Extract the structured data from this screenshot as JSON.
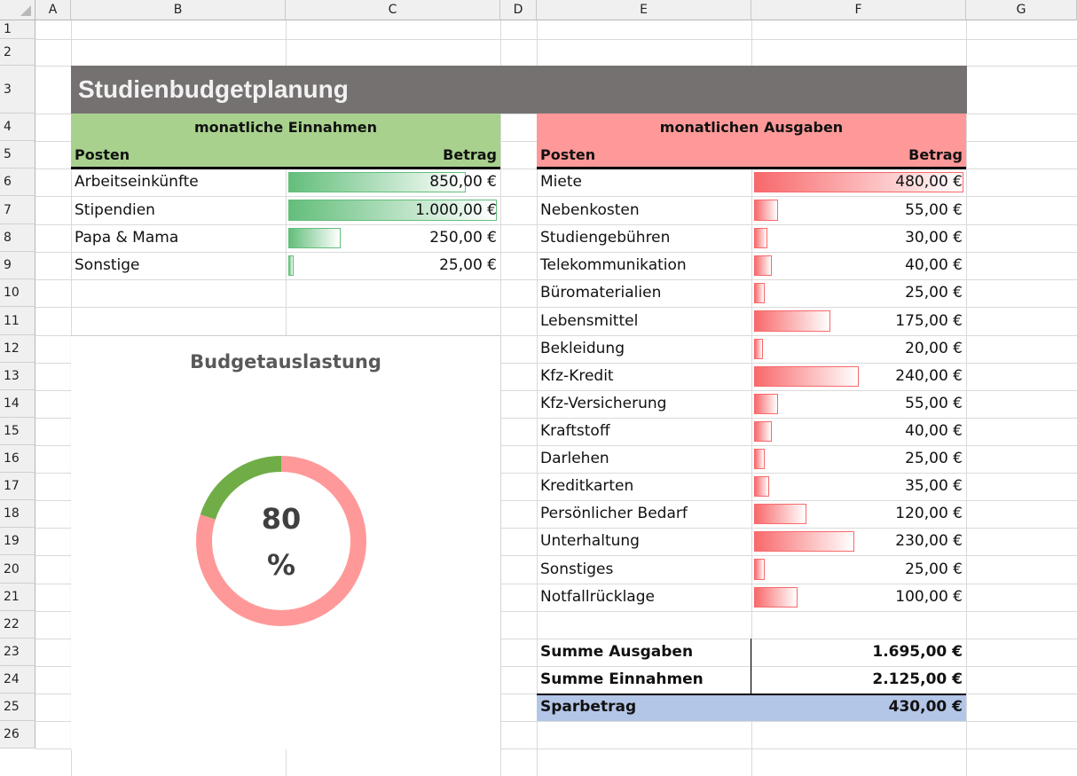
{
  "columns": [
    "A",
    "B",
    "C",
    "D",
    "E",
    "F",
    "G"
  ],
  "rows": [
    "1",
    "2",
    "3",
    "4",
    "5",
    "6",
    "7",
    "8",
    "9",
    "10",
    "11",
    "12",
    "13",
    "14",
    "15",
    "16",
    "17",
    "18",
    "19",
    "20",
    "21",
    "22",
    "23",
    "24",
    "25",
    "26"
  ],
  "title": "Studienbudgetplanung",
  "income": {
    "header": "monatliche Einnahmen",
    "col_posten": "Posten",
    "col_betrag": "Betrag",
    "items": [
      {
        "label": "Arbeitseinkünfte",
        "value": "850,00 €",
        "fraction": 0.85
      },
      {
        "label": "Stipendien",
        "value": "1.000,00 €",
        "fraction": 1.0
      },
      {
        "label": "Papa & Mama",
        "value": "250,00 €",
        "fraction": 0.25
      },
      {
        "label": "Sonstige",
        "value": "25,00 €",
        "fraction": 0.025
      }
    ],
    "color": "#a9d18e"
  },
  "expenses": {
    "header": "monatlichen Ausgaben",
    "col_posten": "Posten",
    "col_betrag": "Betrag",
    "items": [
      {
        "label": "Miete",
        "value": "480,00 €",
        "fraction": 1.0
      },
      {
        "label": "Nebenkosten",
        "value": "55,00 €",
        "fraction": 0.115
      },
      {
        "label": "Studiengebühren",
        "value": "30,00 €",
        "fraction": 0.0625
      },
      {
        "label": "Telekommunikation",
        "value": "40,00 €",
        "fraction": 0.083
      },
      {
        "label": "Büromaterialien",
        "value": "25,00 €",
        "fraction": 0.052
      },
      {
        "label": "Lebensmittel",
        "value": "175,00 €",
        "fraction": 0.365
      },
      {
        "label": "Bekleidung",
        "value": "20,00 €",
        "fraction": 0.042
      },
      {
        "label": "Kfz-Kredit",
        "value": "240,00 €",
        "fraction": 0.5
      },
      {
        "label": "Kfz-Versicherung",
        "value": "55,00 €",
        "fraction": 0.115
      },
      {
        "label": "Kraftstoff",
        "value": "40,00 €",
        "fraction": 0.083
      },
      {
        "label": "Darlehen",
        "value": "25,00 €",
        "fraction": 0.052
      },
      {
        "label": "Kreditkarten",
        "value": "35,00 €",
        "fraction": 0.073
      },
      {
        "label": "Persönlicher Bedarf",
        "value": "120,00 €",
        "fraction": 0.25
      },
      {
        "label": "Unterhaltung",
        "value": "230,00 €",
        "fraction": 0.479
      },
      {
        "label": "Sonstiges",
        "value": "25,00 €",
        "fraction": 0.052
      },
      {
        "label": "Notfallrücklage",
        "value": "100,00 €",
        "fraction": 0.208
      }
    ],
    "color": "#ff9999"
  },
  "summary": {
    "sum_expenses_label": "Summe Ausgaben",
    "sum_expenses_value": "1.695,00 €",
    "sum_income_label": "Summe Einnahmen",
    "sum_income_value": "2.125,00 €",
    "savings_label": "Sparbetrag",
    "savings_value": "430,00 €",
    "savings_color": "#b4c6e7"
  },
  "gauge": {
    "title": "Budgetauslastung",
    "value_number": "80",
    "value_unit": "%",
    "fraction": 0.8,
    "used_color": "#ff9999",
    "free_color": "#70ad47"
  }
}
